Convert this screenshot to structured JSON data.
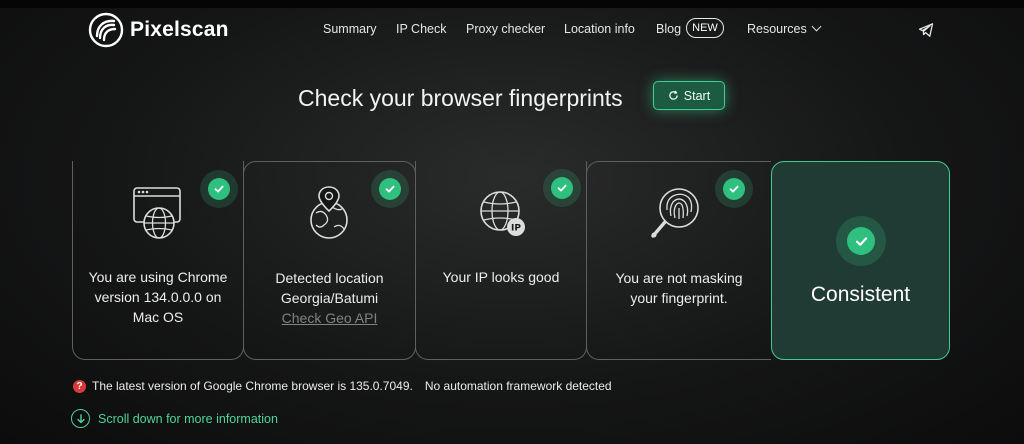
{
  "brand": {
    "name": "Pixelscan"
  },
  "nav": {
    "items": [
      "Summary",
      "IP Check",
      "Proxy checker",
      "Location info",
      "Blog",
      "Resources"
    ],
    "blog_badge": "NEW"
  },
  "hero": {
    "title": "Check your browser fingerprints",
    "start_label": "Start"
  },
  "cards": [
    {
      "lines": [
        "You are using Chrome",
        "version 134.0.0.0 on",
        "Mac OS"
      ],
      "icon": "browser-globe-icon"
    },
    {
      "lines": [
        "Detected location",
        "Georgia/Batumi"
      ],
      "link": "Check Geo API",
      "icon": "location-globe-icon"
    },
    {
      "lines": [
        "Your IP looks good"
      ],
      "icon": "ip-globe-icon",
      "icon_badge": "IP"
    },
    {
      "lines": [
        "You are not masking",
        "your fingerprint."
      ],
      "icon": "fingerprint-magnifier-icon"
    }
  ],
  "summary": {
    "label": "Consistent"
  },
  "footer": {
    "warning_text": "The latest version of Google Chrome browser is 135.0.7049.",
    "automation_text": "No automation framework detected",
    "scroll_text": "Scroll down for more information"
  },
  "colors": {
    "accent": "#2fbf7e",
    "accent_border": "#46c990",
    "warning": "#d83a3a",
    "card_border": "#5d6060"
  }
}
